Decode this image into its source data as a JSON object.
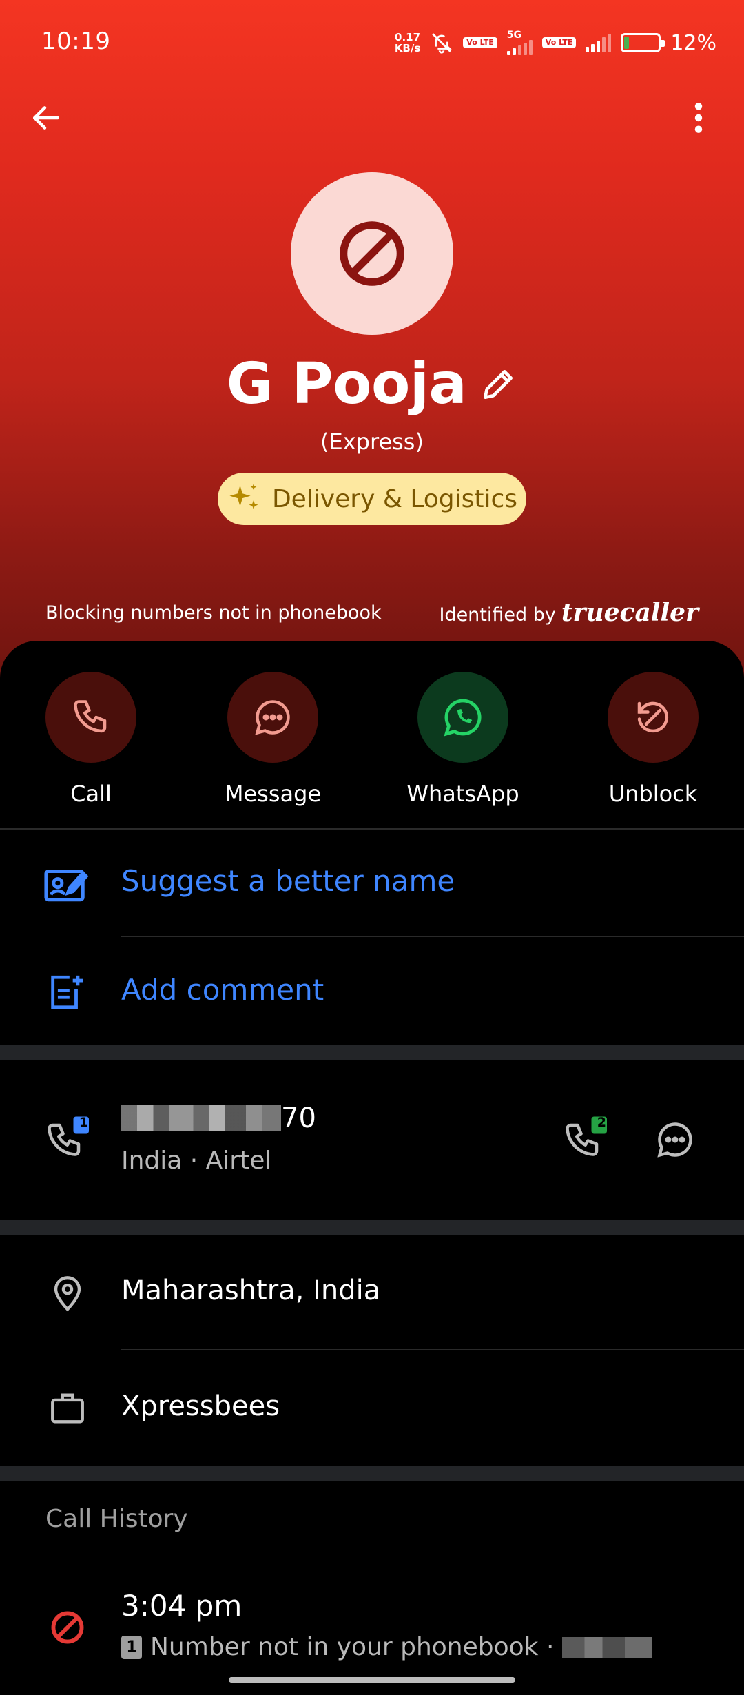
{
  "status_bar": {
    "time": "10:19",
    "net_speed_value": "0.17",
    "net_speed_unit": "KB/s",
    "sim1_label": "Vo LTE",
    "network_type": "5G",
    "sim2_label": "Vo LTE",
    "battery": "12%"
  },
  "contact": {
    "name": "G Pooja",
    "subtitle": "(Express)",
    "tag": "Delivery & Logistics",
    "blocking_text": "Blocking numbers not in phonebook",
    "identified_prefix": "Identified by",
    "identified_brand": "truecaller"
  },
  "actions": [
    {
      "label": "Call"
    },
    {
      "label": "Message"
    },
    {
      "label": "WhatsApp"
    },
    {
      "label": "Unblock"
    }
  ],
  "options": {
    "suggest_name": "Suggest a better name",
    "add_comment": "Add comment"
  },
  "phone": {
    "number_suffix": "70",
    "carrier": "India · Airtel",
    "sim1_badge": "1",
    "sim2_badge": "2"
  },
  "details": {
    "location": "Maharashtra, India",
    "company": "Xpressbees"
  },
  "call_history": {
    "title": "Call History",
    "time": "3:04 pm",
    "sim_badge": "1",
    "description": "Number not in your phonebook ·"
  },
  "colors": {
    "header_top": "#f43522",
    "header_bottom": "#6d140f",
    "link_blue": "#3f86ff",
    "whatsapp_green": "#25d366",
    "blocked_red": "#e53935",
    "tag_bg": "#fde8a0"
  }
}
